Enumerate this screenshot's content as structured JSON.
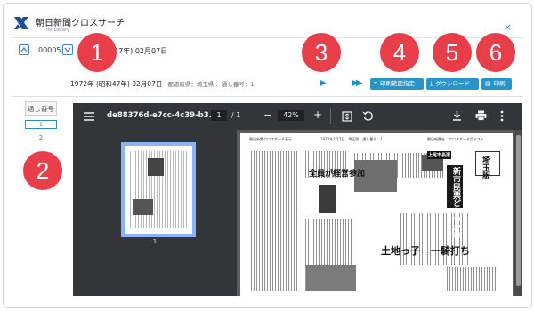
{
  "header": {
    "app_title": "朝日新聞クロスサーチ",
    "app_subtitle": "for Library",
    "close_icon": "×"
  },
  "nav": {
    "issue_number": "00005",
    "date_partial": "47年) 02月07日"
  },
  "badges": [
    "1",
    "2",
    "3",
    "4",
    "5",
    "6"
  ],
  "info": {
    "date": "1972年 (昭和47年) 02月07日",
    "meta": "都道府県：埼玉県 、通し番号：1"
  },
  "toolbar": {
    "print_range_label": "印刷範囲指定",
    "download_label": "ダウンロード",
    "print_label": "印刷"
  },
  "left": {
    "header": "通し番号",
    "selected_page": "1",
    "page_2": "2"
  },
  "viewer": {
    "filename": "de88376d-e7cc-4c39-b3...",
    "page_current": "1",
    "page_total": "/ 1",
    "zoom": "42%",
    "thumb_page_label": "1"
  },
  "newspaper": {
    "top_left": "朝日新聞クロスサーチ表示",
    "top_mid": "1972年2月7日　埼玉版　通し番号：1",
    "top_right": "朝日新聞社　クロスサーチ用テスト",
    "headline_1": "全員が経営参加",
    "headline_2": "新市民票どうつかむ",
    "headline_3": "土地っ子",
    "headline_4": "一騎打ち",
    "column_title": "埼玉版",
    "label_box": "上尾市長選"
  },
  "colors": {
    "accent_blue": "#2a93c8",
    "badge_red": "#e83e4a",
    "viewer_dark": "#323639"
  }
}
